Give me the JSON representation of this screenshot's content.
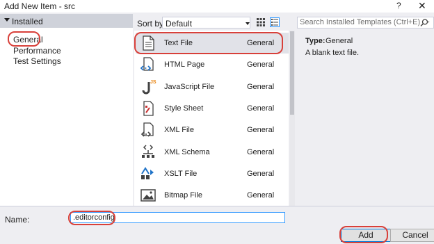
{
  "window": {
    "title": "Add New Item - src",
    "help_label": "?",
    "close_label": "✕"
  },
  "left_pane": {
    "installed_label": "Installed",
    "items": [
      {
        "label": "General"
      },
      {
        "label": "Performance"
      },
      {
        "label": "Test Settings"
      }
    ]
  },
  "toolbar": {
    "sort_label": "Sort by:",
    "sort_value": "Default",
    "search_placeholder": "Search Installed Templates (Ctrl+E)"
  },
  "templates": [
    {
      "name": "Text File",
      "category": "General",
      "icon": "text-file-icon"
    },
    {
      "name": "HTML Page",
      "category": "General",
      "icon": "html-page-icon"
    },
    {
      "name": "JavaScript File",
      "category": "General",
      "icon": "javascript-file-icon"
    },
    {
      "name": "Style Sheet",
      "category": "General",
      "icon": "style-sheet-icon"
    },
    {
      "name": "XML File",
      "category": "General",
      "icon": "xml-file-icon"
    },
    {
      "name": "XML Schema",
      "category": "General",
      "icon": "xml-schema-icon"
    },
    {
      "name": "XSLT File",
      "category": "General",
      "icon": "xslt-file-icon"
    },
    {
      "name": "Bitmap File",
      "category": "General",
      "icon": "bitmap-file-icon"
    }
  ],
  "details": {
    "type_label": "Type:",
    "type_value": "General",
    "description": "A blank text file."
  },
  "name_field": {
    "label": "Name:",
    "value": ".editorconfig"
  },
  "buttons": {
    "add": "Add",
    "cancel": "Cancel"
  },
  "colors": {
    "annotation_red": "#d8403a",
    "selected_row": "#e1e2e8",
    "accent": "#0078d7"
  }
}
